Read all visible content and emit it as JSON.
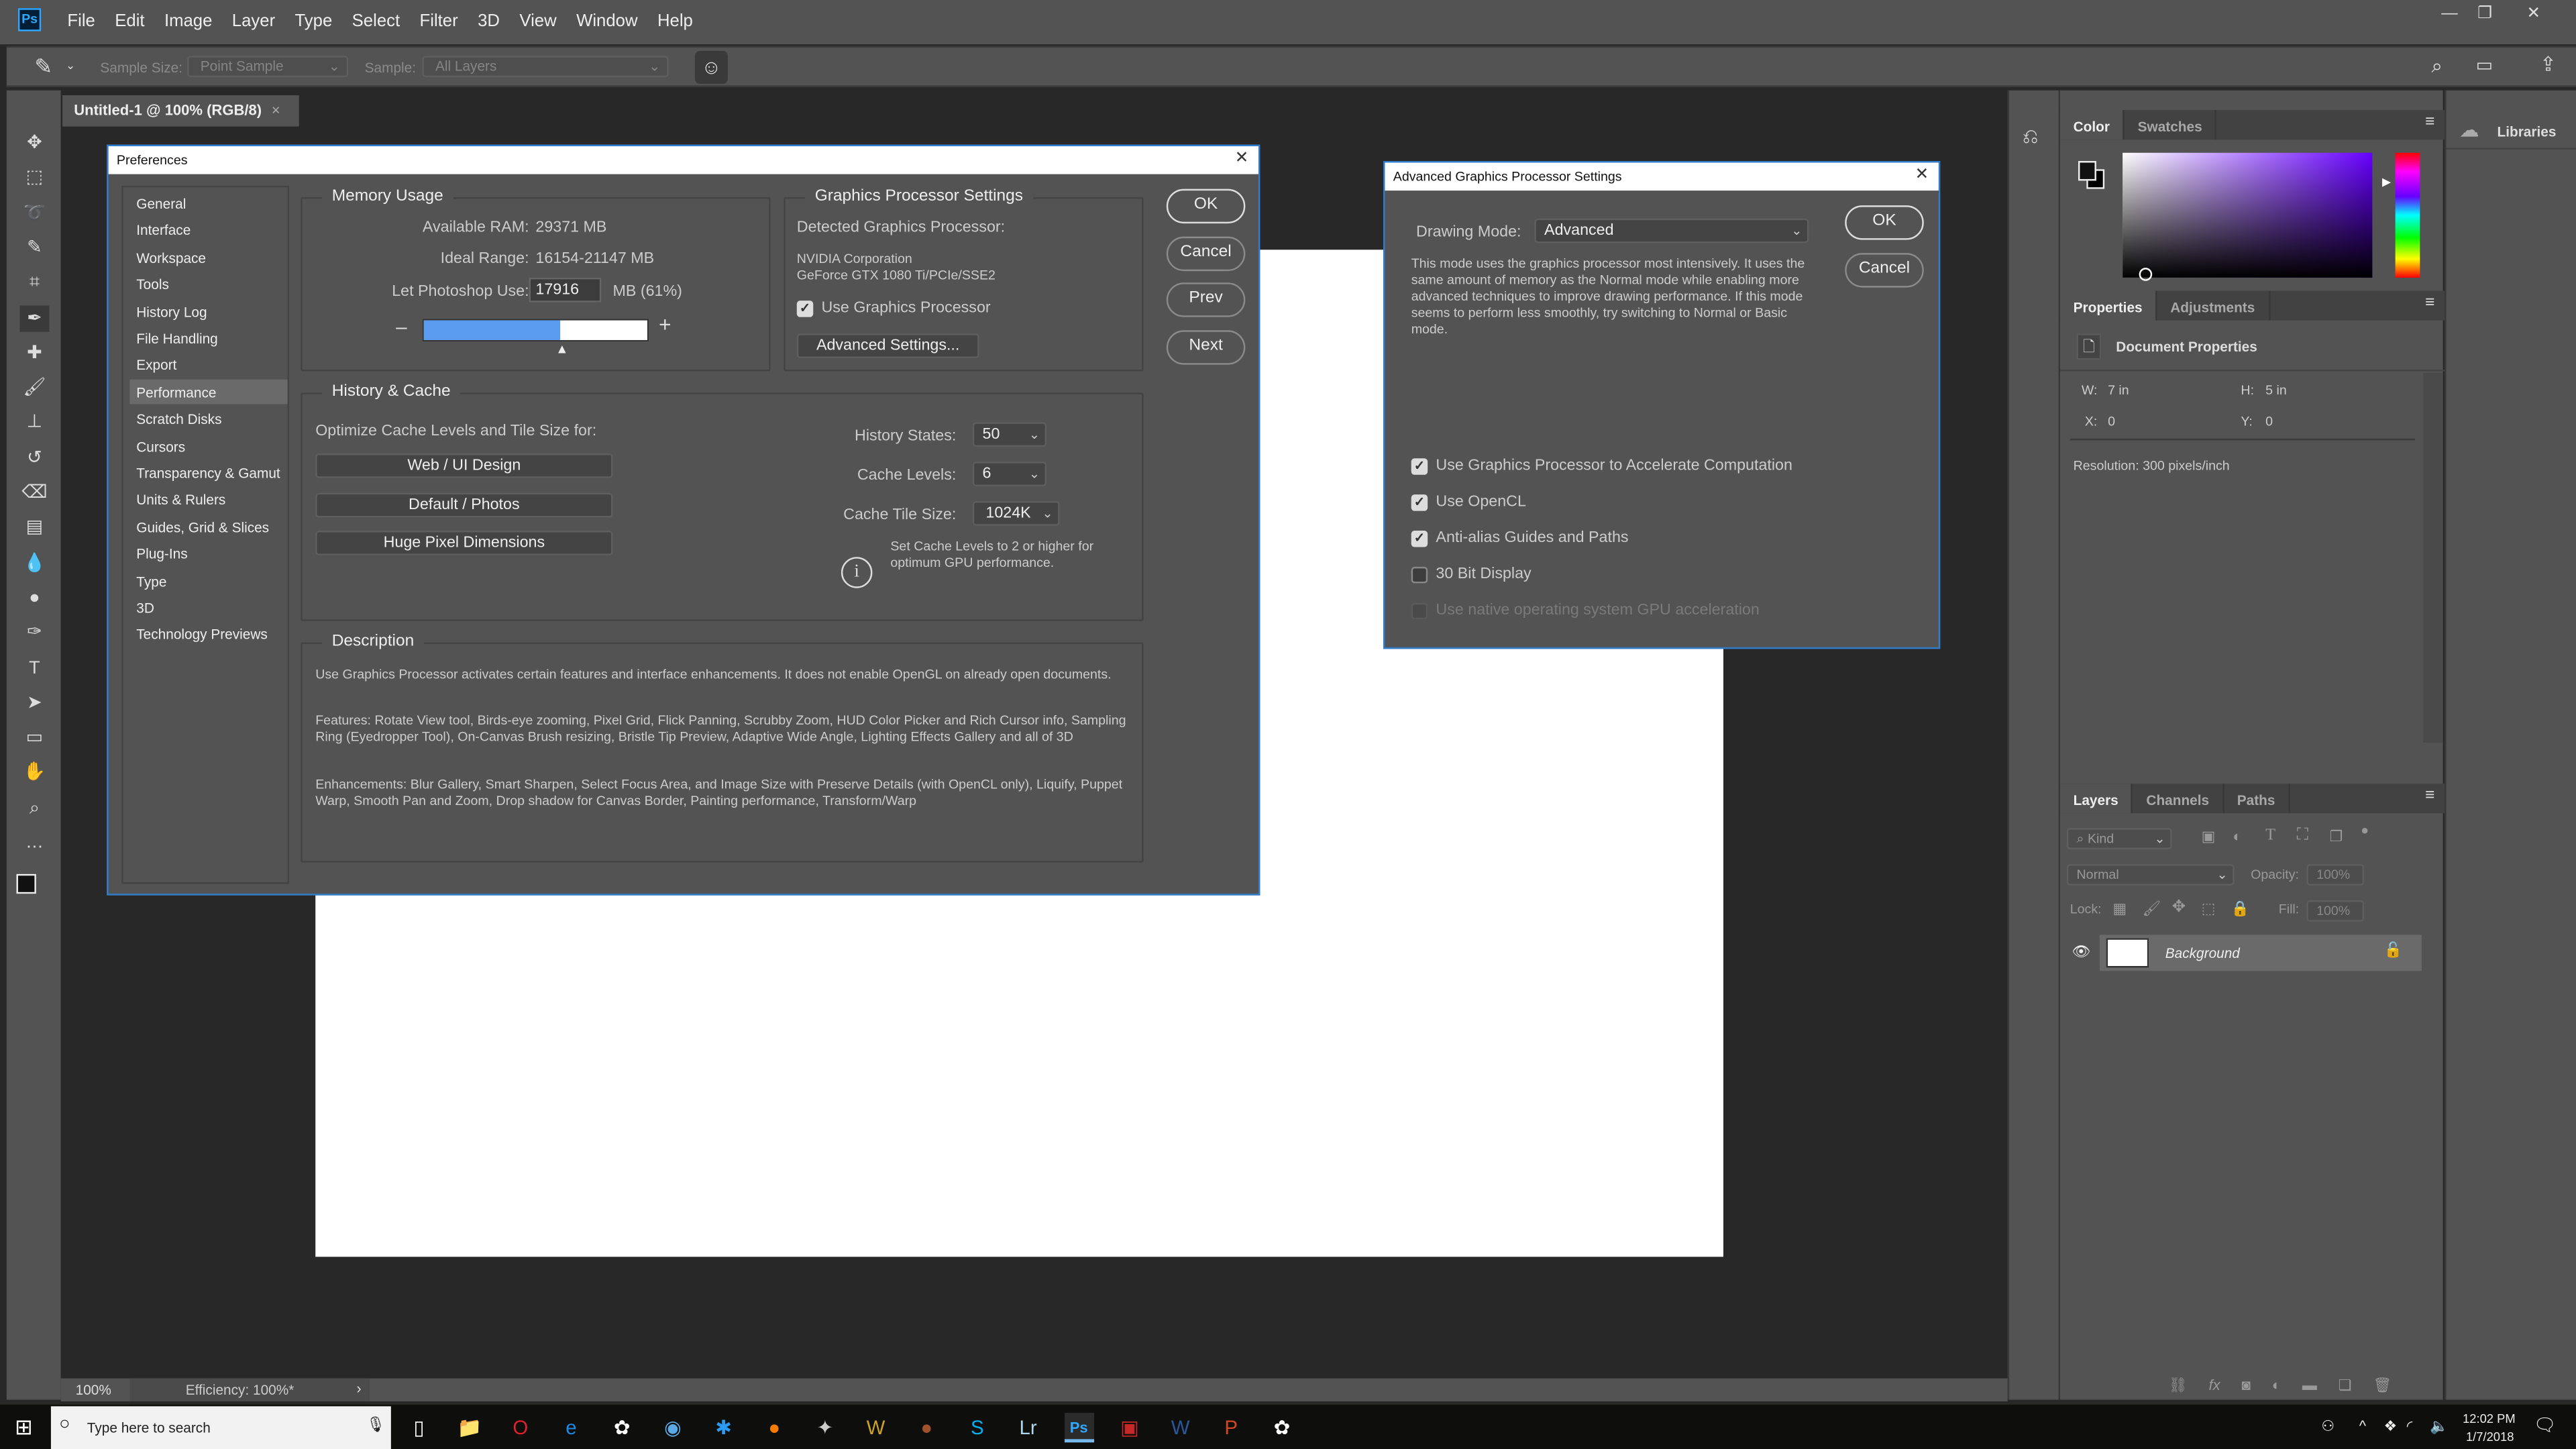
{
  "app": {
    "logo": "Ps",
    "menu": [
      "File",
      "Edit",
      "Image",
      "Layer",
      "Type",
      "Select",
      "Filter",
      "3D",
      "View",
      "Window",
      "Help"
    ]
  },
  "options": {
    "tool_icon": "eyedropper-icon",
    "sample_size_label": "Sample Size:",
    "sample_size_value": "Point Sample",
    "sample_label": "Sample:",
    "sample_value": "All Layers"
  },
  "document": {
    "tab_title": "Untitled-1 @ 100% (RGB/8)",
    "zoom": "100%",
    "efficiency": "Efficiency: 100%*"
  },
  "tools": [
    "move-icon",
    "marquee-icon",
    "lasso-icon",
    "quick-select-icon",
    "crop-icon",
    "eyedropper-icon",
    "healing-icon",
    "brush-icon",
    "stamp-icon",
    "history-brush-icon",
    "eraser-icon",
    "gradient-icon",
    "blur-icon",
    "dodge-icon",
    "pen-icon",
    "type-icon",
    "path-select-icon",
    "rectangle-icon",
    "hand-icon",
    "zoom-icon",
    "more-icon"
  ],
  "preferences": {
    "title": "Preferences",
    "sidebar": [
      "General",
      "Interface",
      "Workspace",
      "Tools",
      "History Log",
      "File Handling",
      "Export",
      "Performance",
      "Scratch Disks",
      "Cursors",
      "Transparency & Gamut",
      "Units & Rulers",
      "Guides, Grid & Slices",
      "Plug-Ins",
      "Type",
      "3D",
      "Technology Previews"
    ],
    "selected": "Performance",
    "memory": {
      "title": "Memory Usage",
      "available_label": "Available RAM:",
      "available_value": "29371 MB",
      "ideal_label": "Ideal Range:",
      "ideal_value": "16154-21147 MB",
      "use_label": "Let Photoshop Use:",
      "use_value": "17916",
      "use_unit": "MB (61%)",
      "slider_percent": 61,
      "minus": "–",
      "plus": "+"
    },
    "gpu": {
      "title": "Graphics Processor Settings",
      "detected_label": "Detected Graphics Processor:",
      "vendor": "NVIDIA Corporation",
      "model": "GeForce GTX 1080 Ti/PCIe/SSE2",
      "use_gpu_label": "Use Graphics Processor",
      "use_gpu_checked": true,
      "advanced_button": "Advanced Settings..."
    },
    "buttons": {
      "ok": "OK",
      "cancel": "Cancel",
      "prev": "Prev",
      "next": "Next"
    },
    "history": {
      "title": "History & Cache",
      "optimize_label": "Optimize Cache Levels and Tile Size for:",
      "presets": [
        "Web / UI Design",
        "Default / Photos",
        "Huge Pixel Dimensions"
      ],
      "history_states_label": "History States:",
      "history_states_value": "50",
      "cache_levels_label": "Cache Levels:",
      "cache_levels_value": "6",
      "tile_size_label": "Cache Tile Size:",
      "tile_size_value": "1024K",
      "info": "Set Cache Levels to 2 or higher for optimum GPU performance."
    },
    "description": {
      "title": "Description",
      "paragraphs": [
        "Use Graphics Processor activates certain features and interface enhancements. It does not enable OpenGL on already open documents.",
        "Features: Rotate View tool, Birds-eye zooming, Pixel Grid, Flick Panning, Scrubby Zoom, HUD Color Picker and Rich Cursor info, Sampling Ring (Eyedropper Tool), On-Canvas Brush resizing, Bristle Tip Preview, Adaptive Wide Angle, Lighting Effects Gallery and all of 3D",
        "Enhancements: Blur Gallery, Smart Sharpen, Select Focus Area, and Image Size with Preserve Details (with OpenCL only), Liquify, Puppet Warp, Smooth Pan and Zoom, Drop shadow for Canvas Border, Painting performance, Transform/Warp"
      ]
    }
  },
  "advanced": {
    "title": "Advanced Graphics Processor Settings",
    "drawing_mode_label": "Drawing Mode:",
    "drawing_mode_value": "Advanced",
    "mode_description": "This mode uses the graphics processor most intensively.  It uses the same amount of memory as the Normal mode while enabling more advanced techniques to improve drawing performance.  If this mode seems to perform less smoothly, try switching to Normal or Basic mode.",
    "ok": "OK",
    "cancel": "Cancel",
    "options": [
      {
        "label": "Use Graphics Processor to Accelerate Computation",
        "checked": true,
        "enabled": true
      },
      {
        "label": "Use OpenCL",
        "checked": true,
        "enabled": true
      },
      {
        "label": "Anti-alias Guides and Paths",
        "checked": true,
        "enabled": true
      },
      {
        "label": "30 Bit Display",
        "checked": false,
        "enabled": true
      },
      {
        "label": "Use native operating system GPU acceleration",
        "checked": false,
        "enabled": false
      }
    ]
  },
  "color_panel": {
    "tabs": [
      "Color",
      "Swatches"
    ],
    "hue_color": "#6600ff"
  },
  "properties_panel": {
    "tabs": [
      "Properties",
      "Adjustments"
    ],
    "heading": "Document Properties",
    "w_label": "W:",
    "w_value": "7 in",
    "h_label": "H:",
    "h_value": "5 in",
    "x_label": "X:",
    "x_value": "0",
    "y_label": "Y:",
    "y_value": "0",
    "resolution": "Resolution: 300 pixels/inch"
  },
  "layers_panel": {
    "tabs": [
      "Layers",
      "Channels",
      "Paths"
    ],
    "filter": "Kind",
    "blend_mode": "Normal",
    "opacity_label": "Opacity:",
    "opacity_value": "100%",
    "lock_label": "Lock:",
    "fill_label": "Fill:",
    "fill_value": "100%",
    "layers": [
      {
        "name": "Background",
        "visible": true,
        "locked": true
      }
    ]
  },
  "libraries": {
    "label": "Libraries"
  },
  "taskbar": {
    "search_placeholder": "Type here to search",
    "time": "12:02 PM",
    "date": "1/7/2018"
  }
}
